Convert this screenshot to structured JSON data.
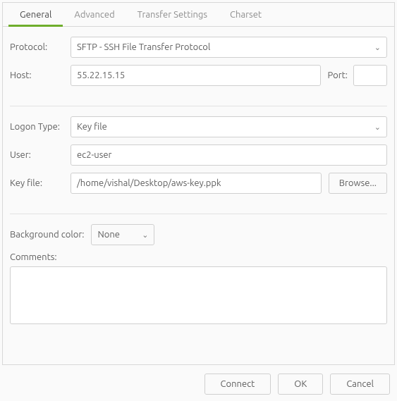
{
  "tabs": {
    "general": "General",
    "advanced": "Advanced",
    "transfer": "Transfer Settings",
    "charset": "Charset"
  },
  "labels": {
    "protocol": "Protocol:",
    "host": "Host:",
    "port": "Port:",
    "logon_type": "Logon Type:",
    "user": "User:",
    "key_file": "Key file:",
    "bgcolor": "Background color:",
    "comments": "Comments:"
  },
  "values": {
    "protocol": "SFTP - SSH File Transfer Protocol",
    "host": "55.22.15.15",
    "port": "",
    "logon_type": "Key file",
    "user": "ec2-user",
    "key_file": "/home/vishal/Desktop/aws-key.ppk",
    "bgcolor": "None",
    "comments": ""
  },
  "buttons": {
    "browse": "Browse...",
    "connect": "Connect",
    "ok": "OK",
    "cancel": "Cancel"
  }
}
